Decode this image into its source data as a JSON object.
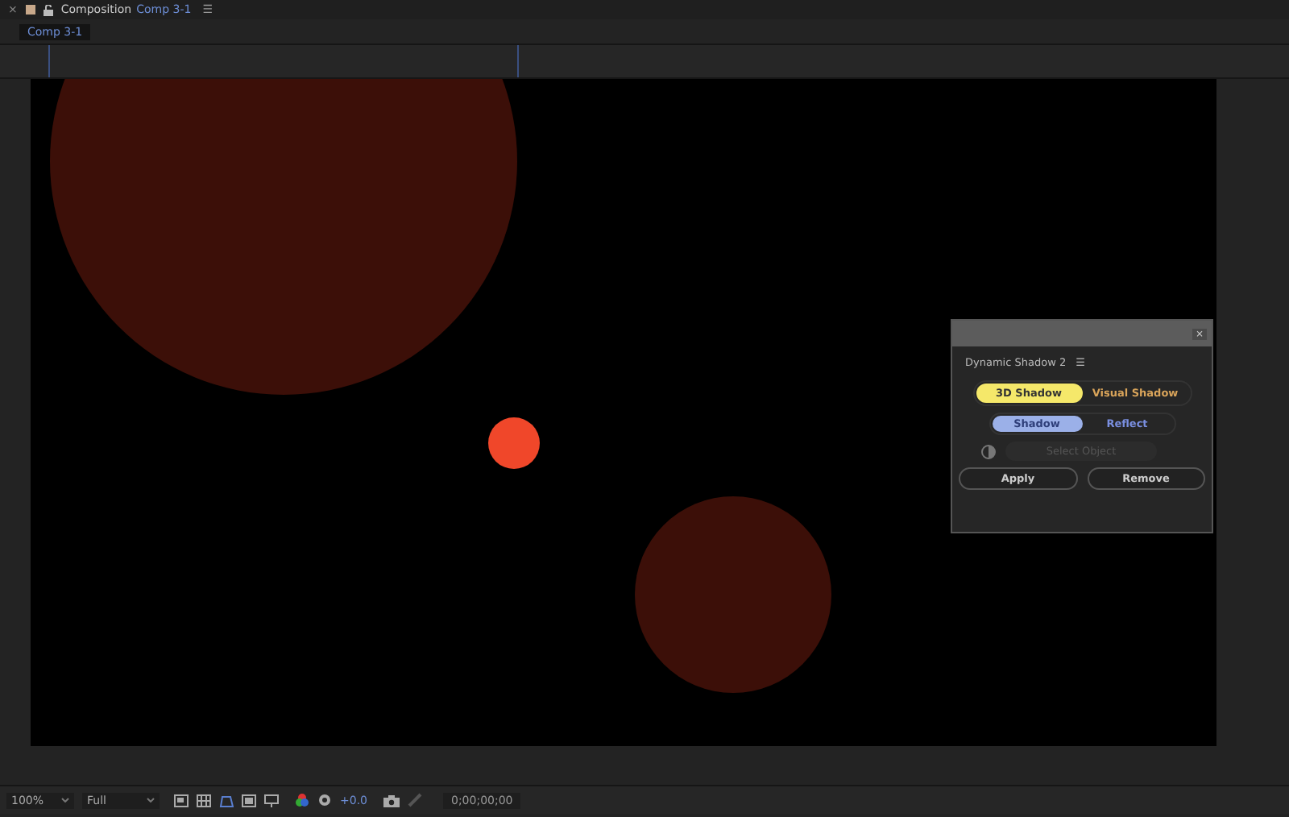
{
  "panel_header": {
    "close": "×",
    "title": "Composition",
    "comp_name": "Comp 3-1",
    "menu": "☰"
  },
  "tabs": [
    {
      "label": "Comp 3-1",
      "selected": true
    }
  ],
  "plugin": {
    "close": "×",
    "title": "Dynamic Shadow 2",
    "menu": "☰",
    "modes": [
      {
        "label": "3D Shadow",
        "selected": true
      },
      {
        "label": "Visual Shadow",
        "selected": false
      }
    ],
    "types": [
      {
        "label": "Shadow",
        "selected": true
      },
      {
        "label": "Reflect",
        "selected": false
      }
    ],
    "select_object": {
      "label": "Select Object",
      "disabled": true
    },
    "buttons": [
      "Apply",
      "Remove"
    ]
  },
  "toolbar": {
    "zoom": "100%",
    "resolution": "Full",
    "exposure": "+0.0",
    "timecode": "0;00;00;00"
  }
}
